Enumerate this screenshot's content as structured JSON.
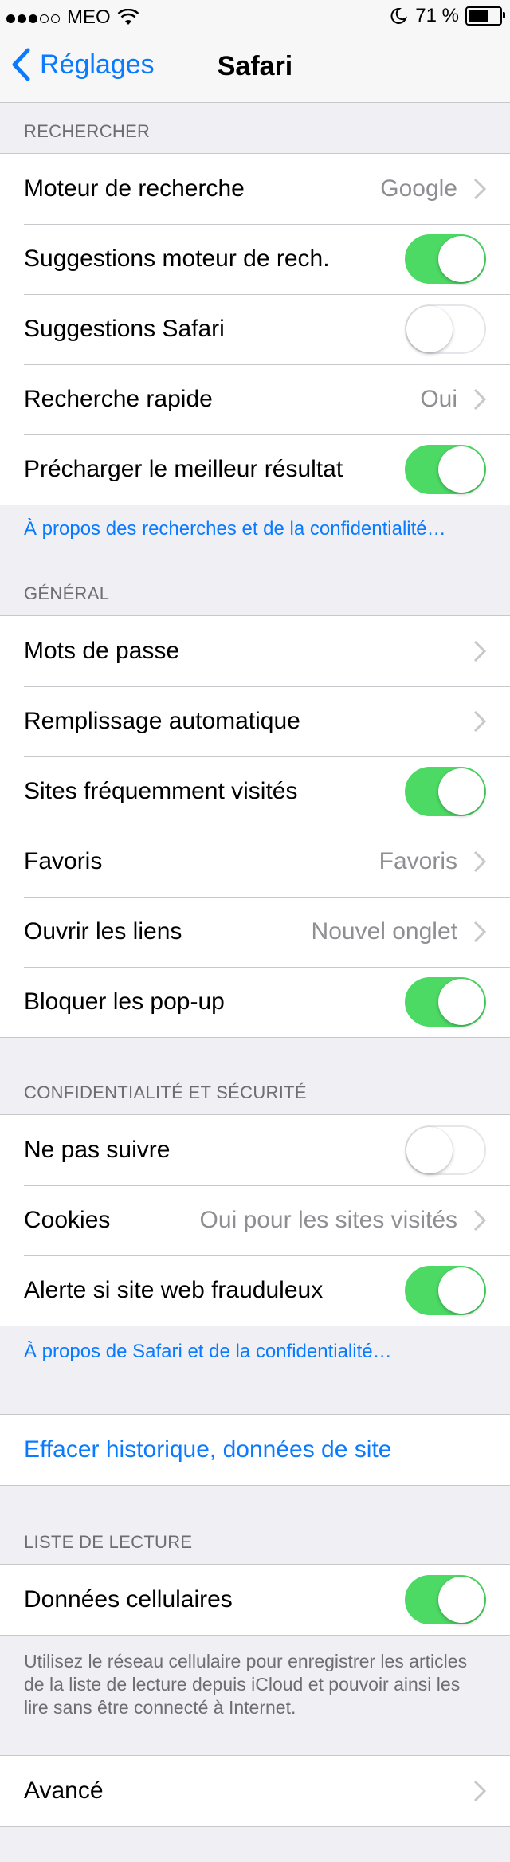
{
  "status_bar": {
    "carrier": "MEO",
    "signal": "●●●○○",
    "battery_text": "71 %",
    "battery_level": 0.71
  },
  "nav": {
    "back_label": "Réglages",
    "title": "Safari"
  },
  "sections": {
    "search": {
      "header": "RECHERCHER",
      "rows": [
        {
          "label": "Moteur de recherche",
          "value": "Google"
        },
        {
          "label": "Suggestions moteur de rech.",
          "toggle": true
        },
        {
          "label": "Suggestions Safari",
          "toggle": false
        },
        {
          "label": "Recherche rapide",
          "value": "Oui"
        },
        {
          "label": "Précharger le meilleur résultat",
          "toggle": true
        }
      ],
      "footer_link": "À propos des recherches et de la confidentialité…"
    },
    "general": {
      "header": "GÉNÉRAL",
      "rows": [
        {
          "label": "Mots de passe"
        },
        {
          "label": "Remplissage automatique"
        },
        {
          "label": "Sites fréquemment visités",
          "toggle": true
        },
        {
          "label": "Favoris",
          "value": "Favoris"
        },
        {
          "label": "Ouvrir les liens",
          "value": "Nouvel onglet"
        },
        {
          "label": "Bloquer les pop-up",
          "toggle": true
        }
      ]
    },
    "privacy": {
      "header": "CONFIDENTIALITÉ ET SÉCURITÉ",
      "rows": [
        {
          "label": "Ne pas suivre",
          "toggle": false
        },
        {
          "label": "Cookies",
          "value": "Oui pour les sites visités"
        },
        {
          "label": "Alerte si site web frauduleux",
          "toggle": true
        }
      ],
      "footer_link": "À propos de Safari et de la confidentialité…"
    },
    "clear": {
      "action_label": "Effacer historique, données de site"
    },
    "reading_list": {
      "header": "LISTE DE LECTURE",
      "rows": [
        {
          "label": "Données cellulaires",
          "toggle": true
        }
      ],
      "footer_text": "Utilisez le réseau cellulaire pour enregistrer les articles de la liste de lecture depuis iCloud et pouvoir ainsi les lire sans être connecté à Internet."
    },
    "advanced": {
      "rows": [
        {
          "label": "Avancé"
        }
      ]
    }
  },
  "colors": {
    "accent": "#0a7aff",
    "toggle_on": "#4cd964",
    "background": "#efeff4"
  }
}
